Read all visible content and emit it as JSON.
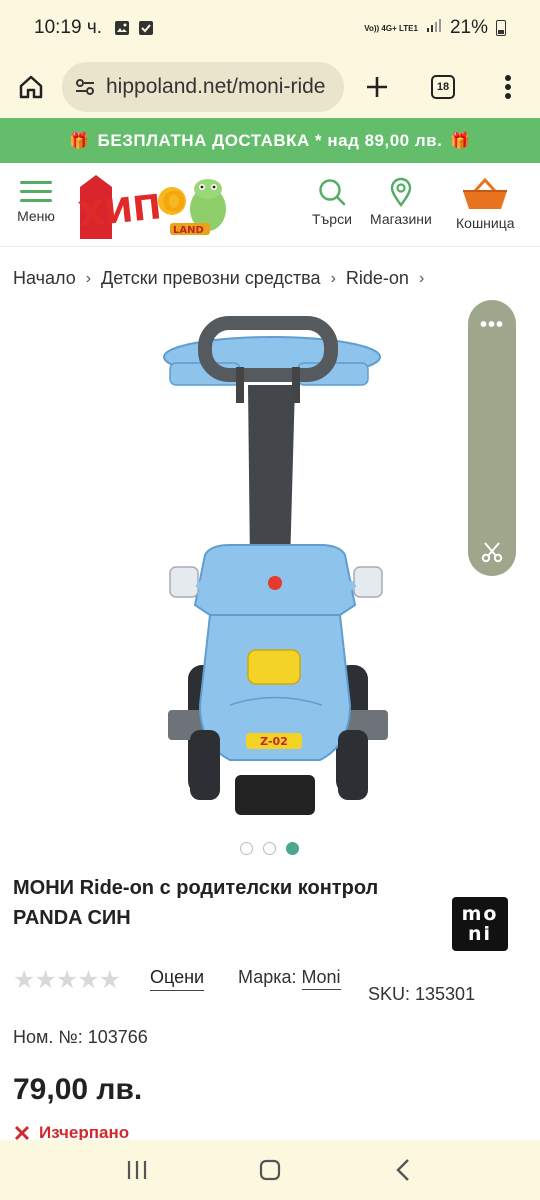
{
  "status_bar": {
    "time": "10:19 ч.",
    "network": "Vo)) 4G+ LTE1",
    "battery": "21%"
  },
  "browser": {
    "url": "hippoland.net/moni-ride",
    "tab_count": "18"
  },
  "promo": {
    "text": "БЕЗПЛАТНА ДОСТАВКА * над 89,00 лв."
  },
  "header": {
    "menu_label": "Меню",
    "logo_text": "ХИПО LAND",
    "search_label": "Търси",
    "stores_label": "Магазини",
    "cart_label": "Кошница"
  },
  "breadcrumb": {
    "items": [
      "Начало",
      "Детски превозни средства",
      "Ride-on"
    ]
  },
  "gallery": {
    "image_text": "Z-02",
    "slide_count": 3,
    "active_slide": 3
  },
  "product": {
    "title": "МОНИ Ride-on с родителски контрол PANDA СИН",
    "brand_logo_top": "mo",
    "brand_logo_bottom": "ni",
    "stars": "★★★★★",
    "rating_value": 0,
    "rate_label": "Оцени",
    "brand_prefix": "Марка:",
    "brand_name": "Moni",
    "sku": "SKU: 135301",
    "nom": "Ном. №: 103766",
    "price": "79,00 лв.",
    "stock": "Изчерпано"
  },
  "colors": {
    "promo_green": "#63bd6b",
    "accent_green": "#53ad63",
    "cart_orange": "#e9731f",
    "out_of_stock_red": "#d12a2a",
    "product_blue": "#8ec3ec"
  }
}
